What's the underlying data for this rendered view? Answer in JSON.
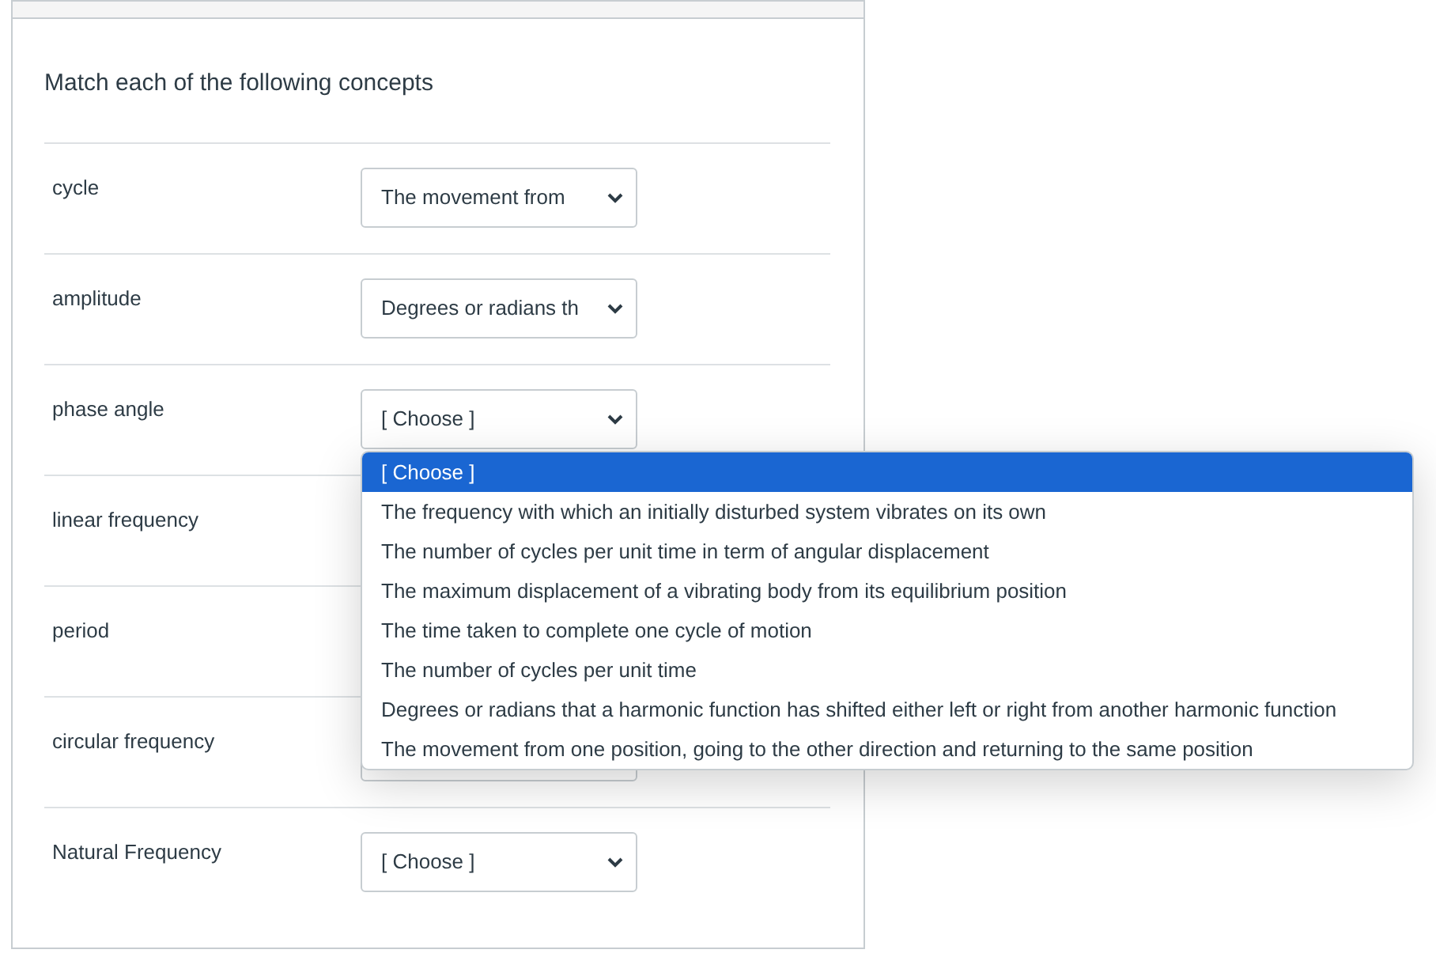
{
  "question": {
    "prompt": "Match each of the following concepts",
    "rows": [
      {
        "label": "cycle",
        "value": "The movement from"
      },
      {
        "label": "amplitude",
        "value": "Degrees or radians th"
      },
      {
        "label": "phase angle",
        "value": "[ Choose ]",
        "options": [
          {
            "label": "[ Choose ]",
            "selected": true
          },
          {
            "label": "The frequency with which an initially disturbed system vibrates on its own",
            "selected": false
          },
          {
            "label": "The number of cycles per unit time in term of angular displacement",
            "selected": false
          },
          {
            "label": "The maximum displacement of a vibrating body from its equilibrium position",
            "selected": false
          },
          {
            "label": "The time taken to complete one cycle of motion",
            "selected": false
          },
          {
            "label": "The number of cycles per unit time",
            "selected": false
          },
          {
            "label": "Degrees or radians that a harmonic function has shifted either left or right from another harmonic function",
            "selected": false
          },
          {
            "label": "The movement from one position, going to the other direction and returning to the same position",
            "selected": false
          }
        ]
      },
      {
        "label": "linear frequency"
      },
      {
        "label": "period"
      },
      {
        "label": "circular frequency"
      },
      {
        "label": "Natural Frequency",
        "value": "[ Choose ]"
      }
    ]
  }
}
